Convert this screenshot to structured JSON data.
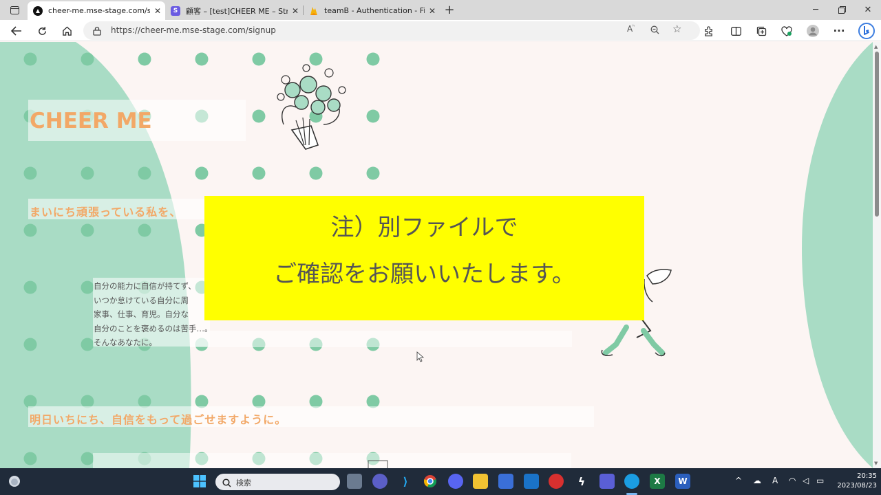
{
  "browser": {
    "tabs": [
      {
        "title": "cheer-me.mse-stage.com/signup",
        "active": true
      },
      {
        "title": "顧客 – [test]CHEER ME – Stripe [テ",
        "active": false
      },
      {
        "title": "teamB - Authentication - Fireba:",
        "active": false
      }
    ],
    "new_tab": "+",
    "address": "https://cheer-me.mse-stage.com/signup"
  },
  "page": {
    "title": "CHEER ME",
    "subtitle_1": "まいにち頑張っている私を、",
    "paragraph": [
      "自分の能力に自信が持てず、",
      "いつか怠けている自分に周",
      "家事、仕事、育児。自分な",
      "自分のことを褒めるのは苦手…。",
      "そんなあなたに。"
    ],
    "subtitle_2": "明日いちにち、自信をもって過ごせますように。",
    "notice_line_1": "注）別ファイルで",
    "notice_line_2": "ご確認をお願いいたします。"
  },
  "taskbar": {
    "search_placeholder": "検索",
    "time": "20:35",
    "date": "2023/08/23"
  },
  "colors": {
    "accent_orange": "#f2a867",
    "mint": "#a9dcc5",
    "dot": "#7fcaa4",
    "notice_yellow": "#ffff00",
    "page_bg": "#fcf5f3"
  }
}
